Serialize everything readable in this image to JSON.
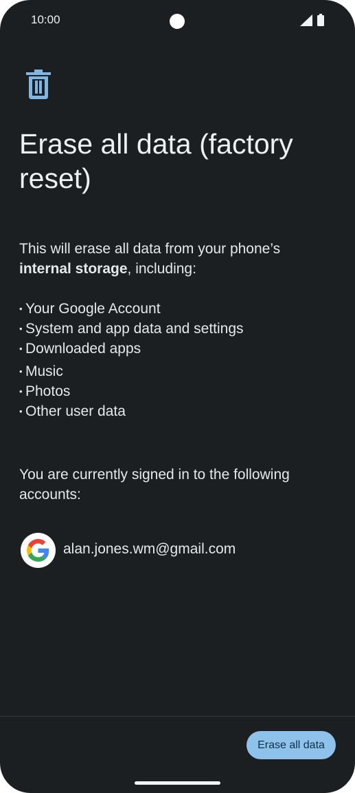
{
  "status_bar": {
    "time": "10:00"
  },
  "header": {
    "icon": "trash-icon",
    "title": "Erase all data (factory reset)"
  },
  "description": {
    "lead": "This will erase all data from your phone’s",
    "bold": "internal storage",
    "tail": ", including:"
  },
  "items": [
    "Your Google Account",
    "System and app data and settings",
    "Downloaded apps",
    "Music",
    "Photos",
    "Other user data"
  ],
  "accounts": {
    "heading": "You are currently signed in to the following accounts:",
    "list": [
      {
        "icon": "google-icon",
        "email": "alan.jones.wm@gmail.com"
      }
    ]
  },
  "actions": {
    "erase_label": "Erase all data"
  },
  "colors": {
    "accent": "#8ec2ea",
    "background": "#1b1f22",
    "icon": "#7fb6e3"
  }
}
